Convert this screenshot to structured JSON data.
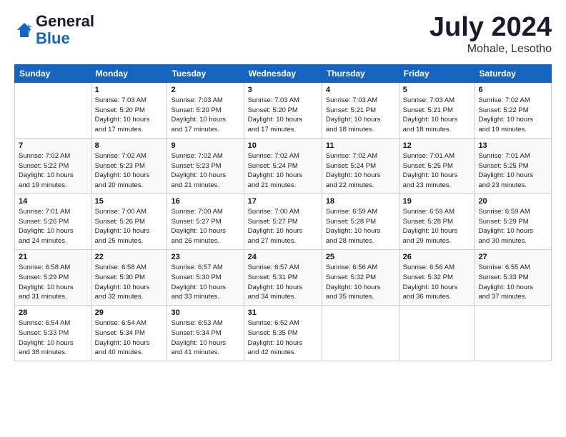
{
  "header": {
    "logo_general": "General",
    "logo_blue": "Blue",
    "month_year": "July 2024",
    "location": "Mohale, Lesotho"
  },
  "weekdays": [
    "Sunday",
    "Monday",
    "Tuesday",
    "Wednesday",
    "Thursday",
    "Friday",
    "Saturday"
  ],
  "weeks": [
    [
      {
        "num": "",
        "info": ""
      },
      {
        "num": "1",
        "info": "Sunrise: 7:03 AM\nSunset: 5:20 PM\nDaylight: 10 hours\nand 17 minutes."
      },
      {
        "num": "2",
        "info": "Sunrise: 7:03 AM\nSunset: 5:20 PM\nDaylight: 10 hours\nand 17 minutes."
      },
      {
        "num": "3",
        "info": "Sunrise: 7:03 AM\nSunset: 5:20 PM\nDaylight: 10 hours\nand 17 minutes."
      },
      {
        "num": "4",
        "info": "Sunrise: 7:03 AM\nSunset: 5:21 PM\nDaylight: 10 hours\nand 18 minutes."
      },
      {
        "num": "5",
        "info": "Sunrise: 7:03 AM\nSunset: 5:21 PM\nDaylight: 10 hours\nand 18 minutes."
      },
      {
        "num": "6",
        "info": "Sunrise: 7:02 AM\nSunset: 5:22 PM\nDaylight: 10 hours\nand 19 minutes."
      }
    ],
    [
      {
        "num": "7",
        "info": "Sunrise: 7:02 AM\nSunset: 5:22 PM\nDaylight: 10 hours\nand 19 minutes."
      },
      {
        "num": "8",
        "info": "Sunrise: 7:02 AM\nSunset: 5:23 PM\nDaylight: 10 hours\nand 20 minutes."
      },
      {
        "num": "9",
        "info": "Sunrise: 7:02 AM\nSunset: 5:23 PM\nDaylight: 10 hours\nand 21 minutes."
      },
      {
        "num": "10",
        "info": "Sunrise: 7:02 AM\nSunset: 5:24 PM\nDaylight: 10 hours\nand 21 minutes."
      },
      {
        "num": "11",
        "info": "Sunrise: 7:02 AM\nSunset: 5:24 PM\nDaylight: 10 hours\nand 22 minutes."
      },
      {
        "num": "12",
        "info": "Sunrise: 7:01 AM\nSunset: 5:25 PM\nDaylight: 10 hours\nand 23 minutes."
      },
      {
        "num": "13",
        "info": "Sunrise: 7:01 AM\nSunset: 5:25 PM\nDaylight: 10 hours\nand 23 minutes."
      }
    ],
    [
      {
        "num": "14",
        "info": "Sunrise: 7:01 AM\nSunset: 5:26 PM\nDaylight: 10 hours\nand 24 minutes."
      },
      {
        "num": "15",
        "info": "Sunrise: 7:00 AM\nSunset: 5:26 PM\nDaylight: 10 hours\nand 25 minutes."
      },
      {
        "num": "16",
        "info": "Sunrise: 7:00 AM\nSunset: 5:27 PM\nDaylight: 10 hours\nand 26 minutes."
      },
      {
        "num": "17",
        "info": "Sunrise: 7:00 AM\nSunset: 5:27 PM\nDaylight: 10 hours\nand 27 minutes."
      },
      {
        "num": "18",
        "info": "Sunrise: 6:59 AM\nSunset: 5:28 PM\nDaylight: 10 hours\nand 28 minutes."
      },
      {
        "num": "19",
        "info": "Sunrise: 6:59 AM\nSunset: 5:28 PM\nDaylight: 10 hours\nand 29 minutes."
      },
      {
        "num": "20",
        "info": "Sunrise: 6:59 AM\nSunset: 5:29 PM\nDaylight: 10 hours\nand 30 minutes."
      }
    ],
    [
      {
        "num": "21",
        "info": "Sunrise: 6:58 AM\nSunset: 5:29 PM\nDaylight: 10 hours\nand 31 minutes."
      },
      {
        "num": "22",
        "info": "Sunrise: 6:58 AM\nSunset: 5:30 PM\nDaylight: 10 hours\nand 32 minutes."
      },
      {
        "num": "23",
        "info": "Sunrise: 6:57 AM\nSunset: 5:30 PM\nDaylight: 10 hours\nand 33 minutes."
      },
      {
        "num": "24",
        "info": "Sunrise: 6:57 AM\nSunset: 5:31 PM\nDaylight: 10 hours\nand 34 minutes."
      },
      {
        "num": "25",
        "info": "Sunrise: 6:56 AM\nSunset: 5:32 PM\nDaylight: 10 hours\nand 35 minutes."
      },
      {
        "num": "26",
        "info": "Sunrise: 6:56 AM\nSunset: 5:32 PM\nDaylight: 10 hours\nand 36 minutes."
      },
      {
        "num": "27",
        "info": "Sunrise: 6:55 AM\nSunset: 5:33 PM\nDaylight: 10 hours\nand 37 minutes."
      }
    ],
    [
      {
        "num": "28",
        "info": "Sunrise: 6:54 AM\nSunset: 5:33 PM\nDaylight: 10 hours\nand 38 minutes."
      },
      {
        "num": "29",
        "info": "Sunrise: 6:54 AM\nSunset: 5:34 PM\nDaylight: 10 hours\nand 40 minutes."
      },
      {
        "num": "30",
        "info": "Sunrise: 6:53 AM\nSunset: 5:34 PM\nDaylight: 10 hours\nand 41 minutes."
      },
      {
        "num": "31",
        "info": "Sunrise: 6:52 AM\nSunset: 5:35 PM\nDaylight: 10 hours\nand 42 minutes."
      },
      {
        "num": "",
        "info": ""
      },
      {
        "num": "",
        "info": ""
      },
      {
        "num": "",
        "info": ""
      }
    ]
  ]
}
